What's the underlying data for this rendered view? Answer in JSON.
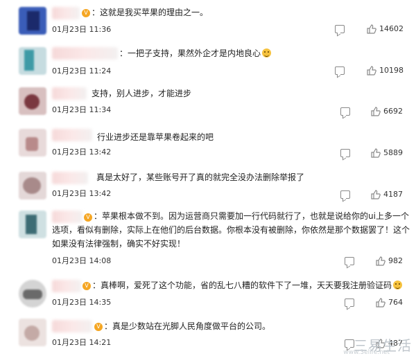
{
  "comments": [
    {
      "text": "：这就是我买苹果的理由之一。",
      "time": "01月23日 11:36",
      "likes": "14602",
      "emoji": false
    },
    {
      "text": "：一把子支持，果然外企才是内地良心",
      "time": "01月23日 11:24",
      "likes": "10198",
      "emoji": true
    },
    {
      "text": "支持，别人进步，才能进步",
      "time": "01月23日 11:34",
      "likes": "6692",
      "emoji": false
    },
    {
      "text": "行业进步还是靠苹果卷起来的吧",
      "time": "01月23日 13:42",
      "likes": "5889",
      "emoji": false
    },
    {
      "text": "真是太好了，某些账号开了真的就完全没办法删除举报了",
      "time": "01月23日 13:42",
      "likes": "4187",
      "emoji": false
    },
    {
      "text": "：苹果根本做不到。因为运营商只需要加一行代码就行了，也就是说给你的ui上多一个选项，看似有删除，实际上在他们的后台数据。你根本没有被删除，你依然是那个数据罢了！这个如果没有法律强制，确实不好实现！",
      "time": "01月23日 14:08",
      "likes": "982",
      "emoji": false
    },
    {
      "text": "：真棒啊，爱死了这个功能，省的乱七八糟的软件下了一堆，天天要我注册验证码",
      "time": "01月23日 14:35",
      "likes": "764",
      "emoji": true
    },
    {
      "text": "：真是少数站在光脚人民角度做平台的公司。",
      "time": "01月23日 14:21",
      "likes": "487",
      "emoji": false
    }
  ],
  "watermark": {
    "text": "三易生活",
    "url": "www.3elife.net"
  },
  "colors": {
    "background": "#ffffff",
    "text": "#222222",
    "icon": "#888888"
  }
}
